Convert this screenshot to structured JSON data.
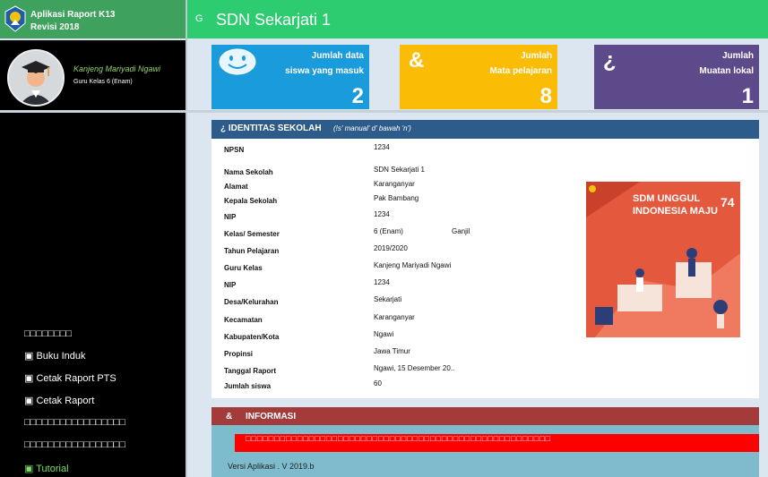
{
  "brand": {
    "line1": "Aplikasi Raport K13",
    "line2": "Revisi 2018"
  },
  "header": {
    "glyph": "G",
    "school_name": "SDN Sekarjati 1"
  },
  "profile": {
    "name": "Kanjeng Mariyadi Ngawi",
    "role": "Guru Kelas 6 (Enam)"
  },
  "sidebar": {
    "items": [
      {
        "label": "□□□□□□□□"
      },
      {
        "label": "▣ Buku Induk"
      },
      {
        "label": "▣ Cetak Raport PTS"
      },
      {
        "label": "▣ Cetak Raport"
      },
      {
        "label": "□□□□□□□□□□□□□□□□□"
      },
      {
        "label": "□□□□□□□□□□□□□□□□□"
      },
      {
        "label": "▣ Tutorial"
      }
    ]
  },
  "cards": [
    {
      "icon": "smiley-icon",
      "line1": "Jumlah data",
      "line2": "siswa yang masuk",
      "value": "2",
      "color": "#1a9bdb"
    },
    {
      "icon": "&",
      "line1": "Jumlah",
      "line2": "Mata pelajaran",
      "value": "8",
      "color": "#fbbc05"
    },
    {
      "icon": "¿",
      "line1": "Jumlah",
      "line2": "Muatan lokal",
      "value": "1",
      "color": "#5d4a8a"
    }
  ],
  "identity": {
    "title": "¿ IDENTITAS SEKOLAH",
    "subtitle": "(!s' manual' d' bawah 'n')",
    "rows": [
      {
        "label": "NPSN",
        "value": "1234"
      },
      {
        "label": "Nama Sekolah",
        "value": "SDN Sekarjati 1"
      },
      {
        "label": "Alamat",
        "value": "Karanganyar"
      },
      {
        "label": "Kepala Sekolah",
        "value": "Pak Bambang"
      },
      {
        "label": "NIP",
        "value": "1234"
      },
      {
        "label": "Kelas/ Semester",
        "value": "6 (Enam)",
        "extra": "Ganjil"
      },
      {
        "label": "Tahun Pelajaran",
        "value": "2019/2020"
      },
      {
        "label": "Guru Kelas",
        "value": "Kanjeng Mariyadi Ngawi"
      },
      {
        "label": "NIP",
        "value": "1234"
      },
      {
        "label": "Desa/Kelurahan",
        "value": "Sekarjati"
      },
      {
        "label": "Kecamatan",
        "value": "Karanganyar"
      },
      {
        "label": "Kabupaten/Kota",
        "value": "Ngawi"
      },
      {
        "label": "Propinsi",
        "value": "Jawa Timur"
      },
      {
        "label": "Tanggal Raport",
        "value": "Ngawi, 15 Desember 20.."
      },
      {
        "label": "Jumlah siswa",
        "value": "60"
      }
    ]
  },
  "poster": {
    "line1": "SDM UNGGUL",
    "line2": "INDONESIA MAJU",
    "badge": "74"
  },
  "info": {
    "icon": "&",
    "title": "INFORMASI",
    "marquee": "□□□□□□□□□□□□□□□□□□□□□□□□□□□□□□□□□□□□□□□□□□□□□□□□□□□□□",
    "version": "Versi Aplikasi . V 2019.b"
  },
  "colors": {
    "header_green": "#2ecc71",
    "brand_green": "#3ea15d",
    "identity_bar": "#2d5c8a",
    "info_bar": "#a33b3b",
    "info_bg": "#7ebccd"
  }
}
